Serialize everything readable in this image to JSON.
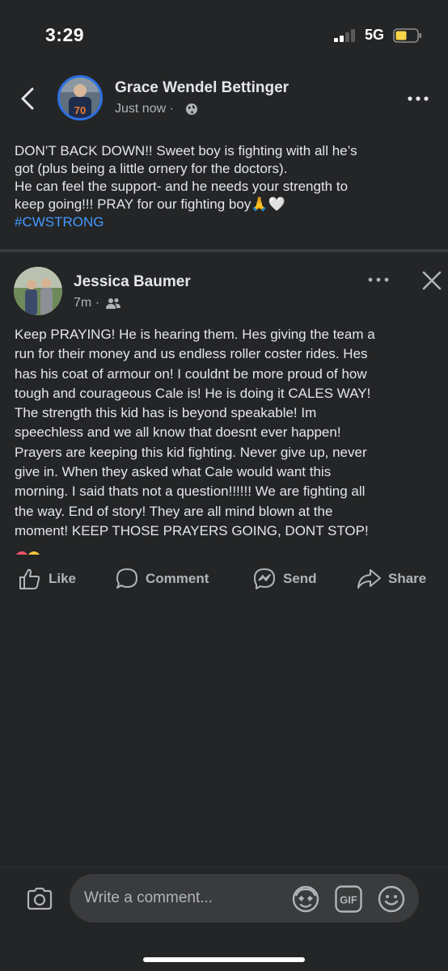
{
  "status_bar": {
    "time": "3:29",
    "network": "5G"
  },
  "post": {
    "author": "Grace Wendel Bettinger",
    "time": "Just now",
    "separator": "·",
    "text_lines": [
      "DON’T BACK DOWN!! Sweet boy is fighting with all he’s",
      "got (plus being a little ornery for the doctors).",
      "He can feel the support- and he needs your strength to",
      "keep going!!! PRAY for our fighting boy🙏🤍"
    ],
    "hashtag": "#CWSTRONG",
    "avatar_jersey_number": "70"
  },
  "comment": {
    "author": "Jessica Baumer",
    "time": "7m",
    "separator": "·",
    "text_lines": [
      "Keep PRAYING! He is hearing them. Hes giving the team a",
      "run for their money and us endless roller coster rides. Hes",
      "has his coat of armour on! I couldnt be more proud of how",
      "tough and courageous Cale is! He is doing it CALES WAY!",
      "The strength this kid has is beyond speakable! Im",
      "speechless and we all know that doesnt ever happen!",
      "Prayers are keeping this kid fighting. Never give up, never",
      "give in. When they asked what Cale would want this",
      "morning. I said thats not a question!!!!!! We are fighting all",
      "the way. End of story! They are all mind blown at the",
      "moment! KEEP THOSE PRAYERS GOING, DONT STOP!"
    ]
  },
  "actions": {
    "like": "Like",
    "comment": "Comment",
    "send": "Send",
    "share": "Share"
  },
  "composer": {
    "placeholder": "Write a comment...",
    "gif_label": "GIF"
  },
  "colors": {
    "background": "#242526",
    "text": "#e4e6eb",
    "secondary_text": "#b0b3b8",
    "link": "#4599ff",
    "avatar_ring": "#2d6fe4"
  }
}
